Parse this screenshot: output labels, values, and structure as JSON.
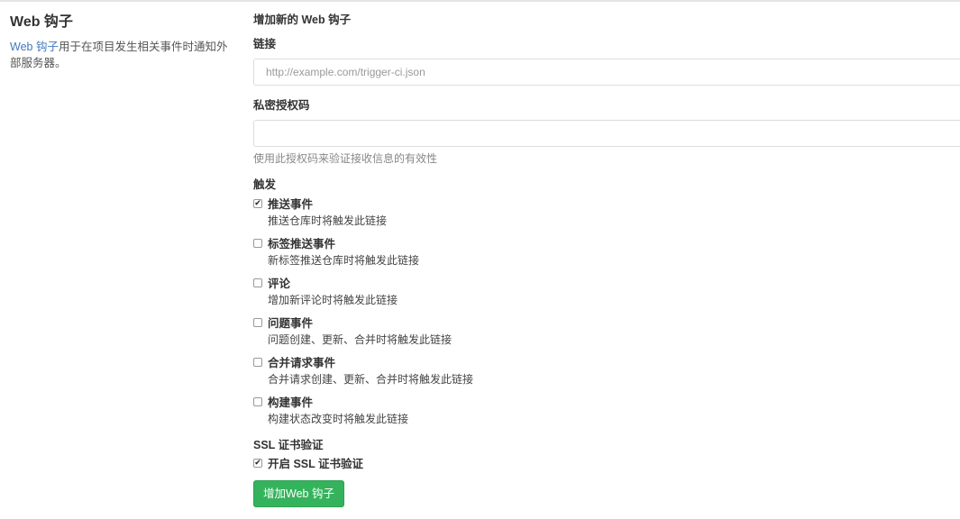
{
  "sidebar": {
    "title": "Web 钩子",
    "desc_link": "Web 钩子",
    "desc_rest": "用于在项目发生相关事件时通知外部服务器。"
  },
  "form": {
    "title": "增加新的 Web 钩子",
    "url_label": "链接",
    "url_placeholder": "http://example.com/trigger-ci.json",
    "url_value": "",
    "secret_label": "私密授权码",
    "secret_value": "",
    "secret_help": "使用此授权码来验证接收信息的有效性",
    "trigger_label": "触发",
    "events": [
      {
        "title": "推送事件",
        "desc": "推送仓库时将触发此链接",
        "checked": true
      },
      {
        "title": "标签推送事件",
        "desc": "新标签推送仓库时将触发此链接",
        "checked": false
      },
      {
        "title": "评论",
        "desc": "增加新评论时将触发此链接",
        "checked": false
      },
      {
        "title": "问题事件",
        "desc": "问题创建、更新、合并时将触发此链接",
        "checked": false
      },
      {
        "title": "合并请求事件",
        "desc": "合并请求创建、更新、合并时将触发此链接",
        "checked": false
      },
      {
        "title": "构建事件",
        "desc": "构建状态改变时将触发此链接",
        "checked": false
      }
    ],
    "ssl_label": "SSL 证书验证",
    "ssl_option": "开启 SSL 证书验证",
    "ssl_checked": true,
    "submit_label": "增加Web 钩子"
  },
  "colors": {
    "link": "#4078c0",
    "button": "#34b35c"
  }
}
